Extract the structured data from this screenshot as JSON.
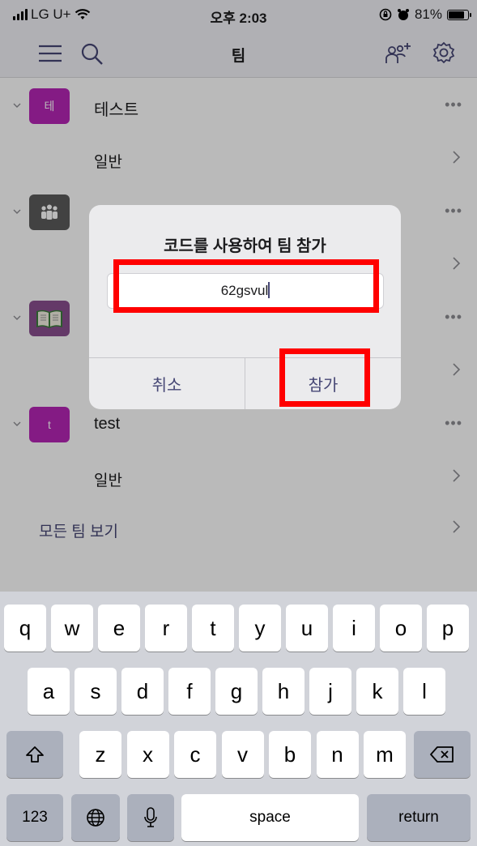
{
  "status": {
    "carrier": "LG U+",
    "time": "오후 2:03",
    "battery_text": "81%",
    "battery_level": 0.81
  },
  "nav": {
    "title": "팀"
  },
  "teams": [
    {
      "name": "테스트",
      "avatar_text": "테",
      "color": "#b526b5",
      "channel": "일반"
    },
    {
      "name": "",
      "avatar_text": "",
      "color": "#5b5b5b",
      "channel": ""
    },
    {
      "name": "",
      "avatar_text": "",
      "color": "#8a4f8f",
      "channel": ""
    },
    {
      "name": "test",
      "avatar_text": "t",
      "color": "#b526b5",
      "channel": "일반"
    }
  ],
  "see_all": "모든 팀 보기",
  "dialog": {
    "title": "코드를 사용하여 팀 참가",
    "code_value": "62gsvul",
    "cancel_label": "취소",
    "join_label": "참가"
  },
  "keyboard": {
    "row1": [
      "q",
      "w",
      "e",
      "r",
      "t",
      "y",
      "u",
      "i",
      "o",
      "p"
    ],
    "row2": [
      "a",
      "s",
      "d",
      "f",
      "g",
      "h",
      "j",
      "k",
      "l"
    ],
    "row3": [
      "z",
      "x",
      "c",
      "v",
      "b",
      "n",
      "m"
    ],
    "numbers_label": "123",
    "space_label": "space",
    "return_label": "return"
  },
  "colors": {
    "accent": "#464775",
    "highlight": "#ff0000"
  }
}
